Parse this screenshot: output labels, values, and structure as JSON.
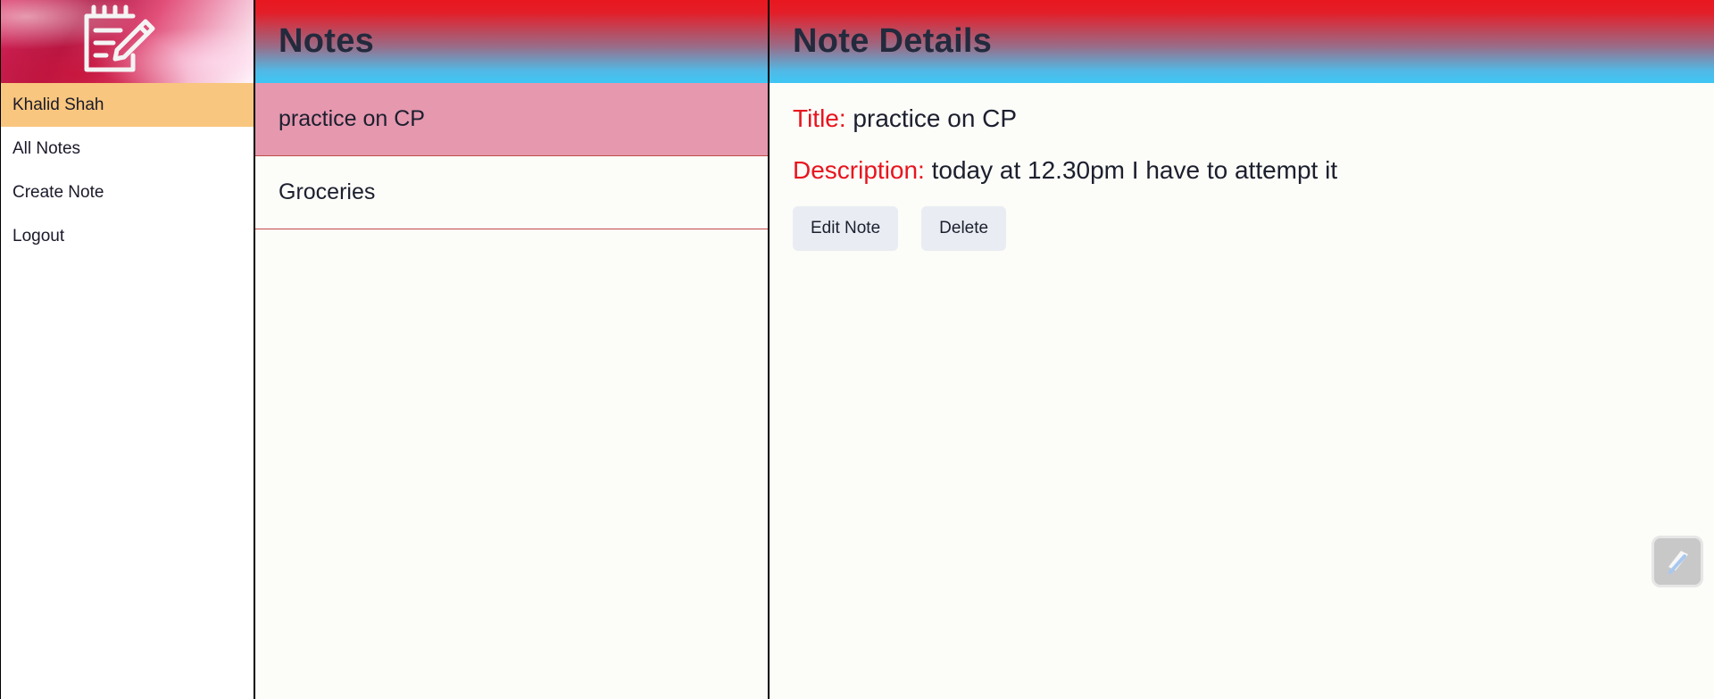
{
  "sidebar": {
    "logo_icon": "notepad-pencil-icon",
    "items": [
      {
        "label": "Khalid Shah"
      },
      {
        "label": "All Notes"
      },
      {
        "label": "Create Note"
      },
      {
        "label": "Logout"
      }
    ]
  },
  "notes_panel": {
    "title": "Notes",
    "notes": [
      {
        "title": "practice on CP"
      },
      {
        "title": "Groceries"
      }
    ]
  },
  "details_panel": {
    "title": "Note Details",
    "title_label": "Title:",
    "title_value": "practice on CP",
    "description_label": "Description:",
    "description_value": "today at 12.30pm I have to attempt it",
    "edit_button_label": "Edit Note",
    "delete_button_label": "Delete",
    "floating_icon": "extension-icon"
  },
  "colors": {
    "active_sidebar": "#f8c67e",
    "selected_note": "#e598ae",
    "label_red": "#e8141e",
    "header_top": "#e8171f",
    "header_bottom": "#3ec6f5"
  }
}
